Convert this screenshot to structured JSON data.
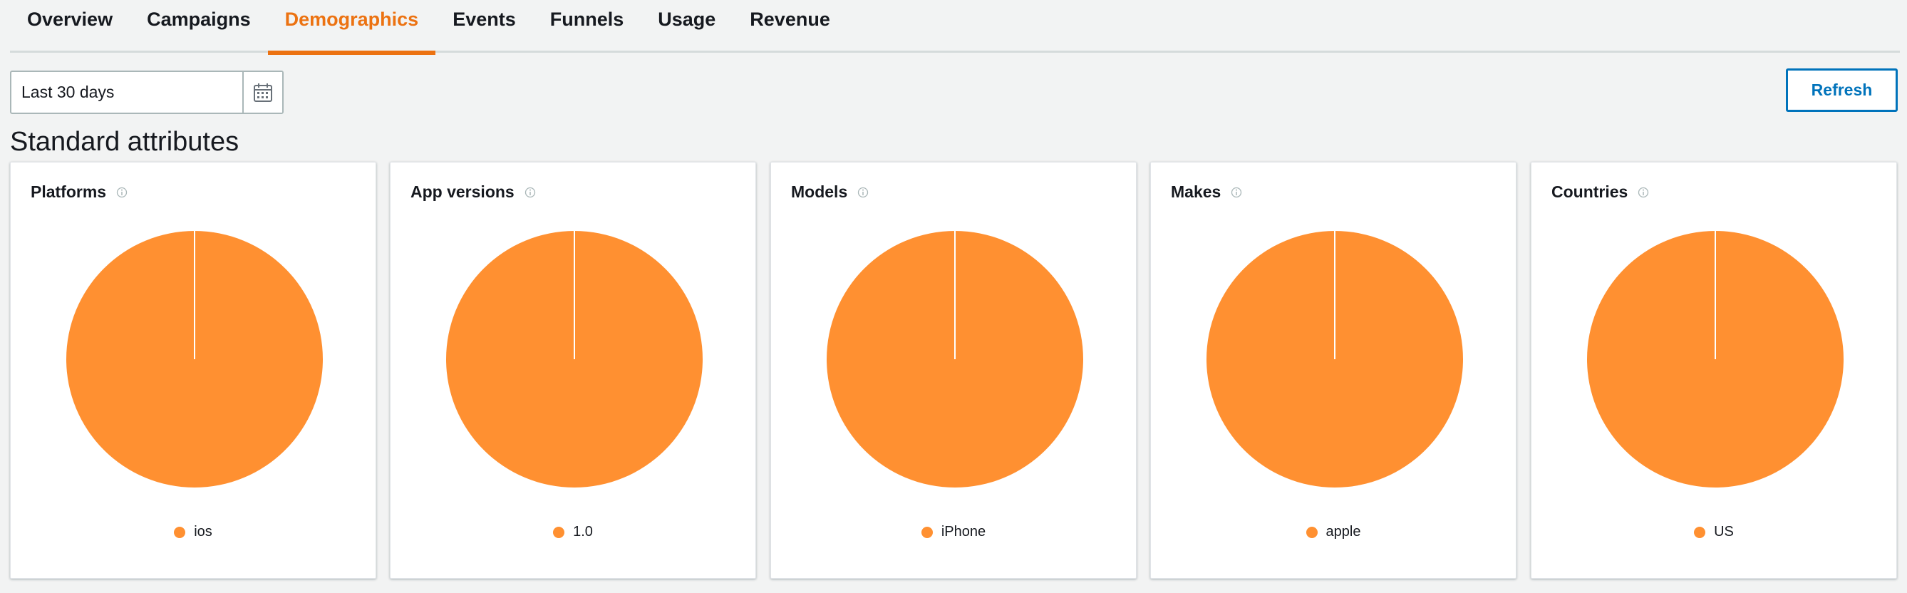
{
  "tabs": [
    {
      "label": "Overview",
      "active": false
    },
    {
      "label": "Campaigns",
      "active": false
    },
    {
      "label": "Demographics",
      "active": true
    },
    {
      "label": "Events",
      "active": false
    },
    {
      "label": "Funnels",
      "active": false
    },
    {
      "label": "Usage",
      "active": false
    },
    {
      "label": "Revenue",
      "active": false
    }
  ],
  "date_range": {
    "value": "Last 30 days"
  },
  "refresh_label": "Refresh",
  "section_title": "Standard attributes",
  "colors": {
    "accent": "#ec7211",
    "slice": "#ff9031",
    "link": "#0073bb"
  },
  "cards": [
    {
      "title": "Platforms"
    },
    {
      "title": "App versions"
    },
    {
      "title": "Models"
    },
    {
      "title": "Makes"
    },
    {
      "title": "Countries"
    }
  ],
  "chart_data": [
    {
      "type": "pie",
      "title": "Platforms",
      "slices": [
        {
          "label": "ios",
          "value": 100
        }
      ]
    },
    {
      "type": "pie",
      "title": "App versions",
      "slices": [
        {
          "label": "1.0",
          "value": 100
        }
      ]
    },
    {
      "type": "pie",
      "title": "Models",
      "slices": [
        {
          "label": "iPhone",
          "value": 100
        }
      ]
    },
    {
      "type": "pie",
      "title": "Makes",
      "slices": [
        {
          "label": "apple",
          "value": 100
        }
      ]
    },
    {
      "type": "pie",
      "title": "Countries",
      "slices": [
        {
          "label": "US",
          "value": 100
        }
      ]
    }
  ]
}
